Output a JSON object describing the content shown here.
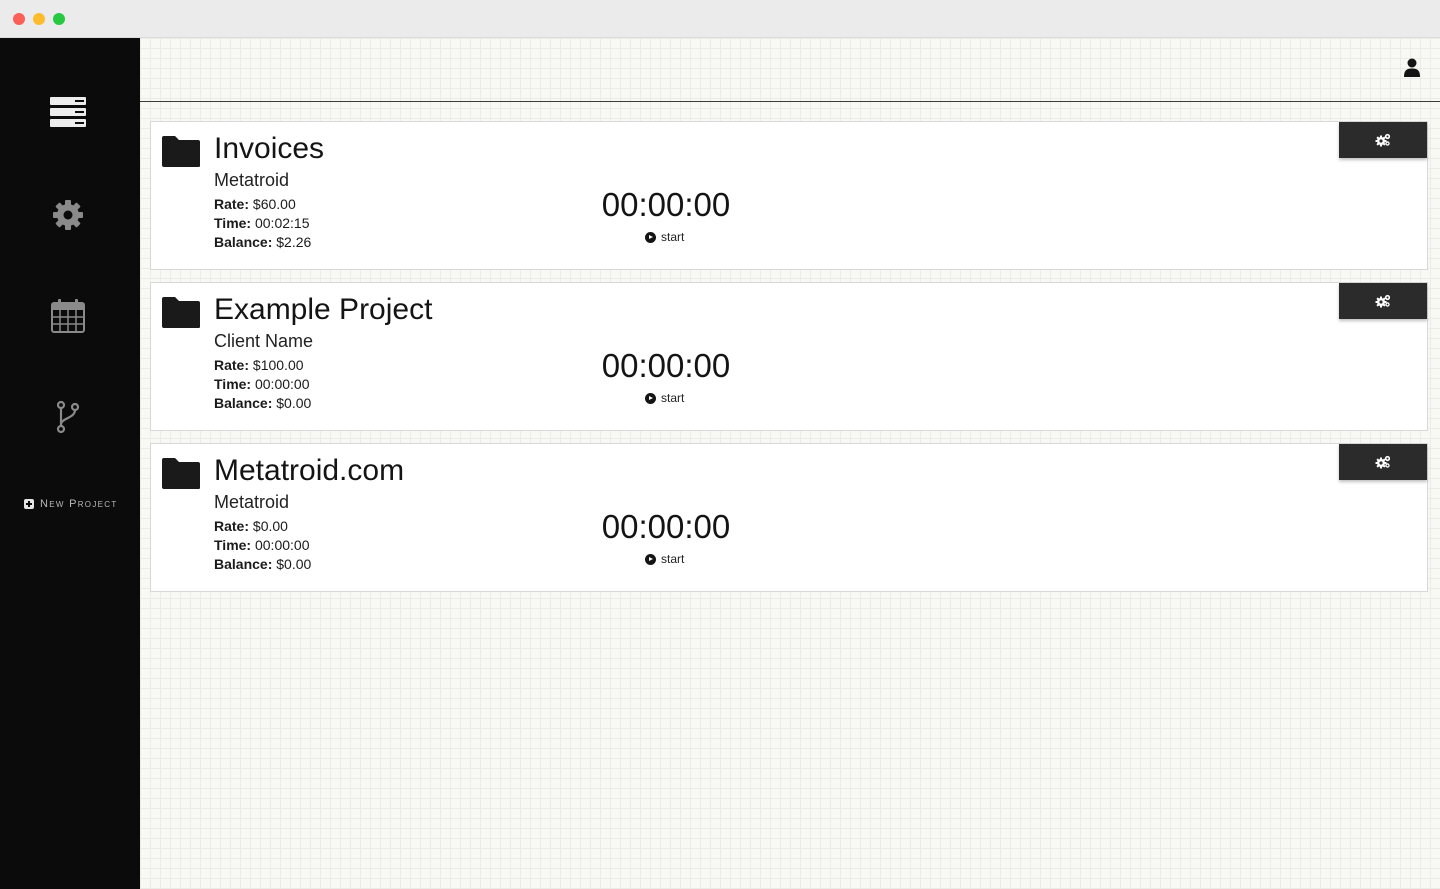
{
  "window": {
    "controls": [
      "close",
      "minimize",
      "maximize"
    ]
  },
  "sidebar": {
    "items": [
      {
        "icon": "stack-icon",
        "label": ""
      },
      {
        "icon": "gear-icon",
        "label": ""
      },
      {
        "icon": "calendar-icon",
        "label": ""
      },
      {
        "icon": "branch-icon",
        "label": ""
      }
    ],
    "new_project_label": "New Project"
  },
  "header": {
    "user_icon": "user-icon"
  },
  "projects": [
    {
      "title": "Invoices",
      "client": "Metatroid",
      "rate_label": "Rate:",
      "rate": "$60.00",
      "time_label": "Time:",
      "time": "00:02:15",
      "balance_label": "Balance:",
      "balance": "$2.26",
      "timer": "00:00:00",
      "start_label": "start"
    },
    {
      "title": "Example Project",
      "client": "Client Name",
      "rate_label": "Rate:",
      "rate": "$100.00",
      "time_label": "Time:",
      "time": "00:00:00",
      "balance_label": "Balance:",
      "balance": "$0.00",
      "timer": "00:00:00",
      "start_label": "start"
    },
    {
      "title": "Metatroid.com",
      "client": "Metatroid",
      "rate_label": "Rate:",
      "rate": "$0.00",
      "time_label": "Time:",
      "time": "00:00:00",
      "balance_label": "Balance:",
      "balance": "$0.00",
      "timer": "00:00:00",
      "start_label": "start"
    }
  ],
  "colors": {
    "sidebar": "#0b0b0b",
    "settings_button": "#2b2b2b",
    "card": "#ffffff"
  }
}
